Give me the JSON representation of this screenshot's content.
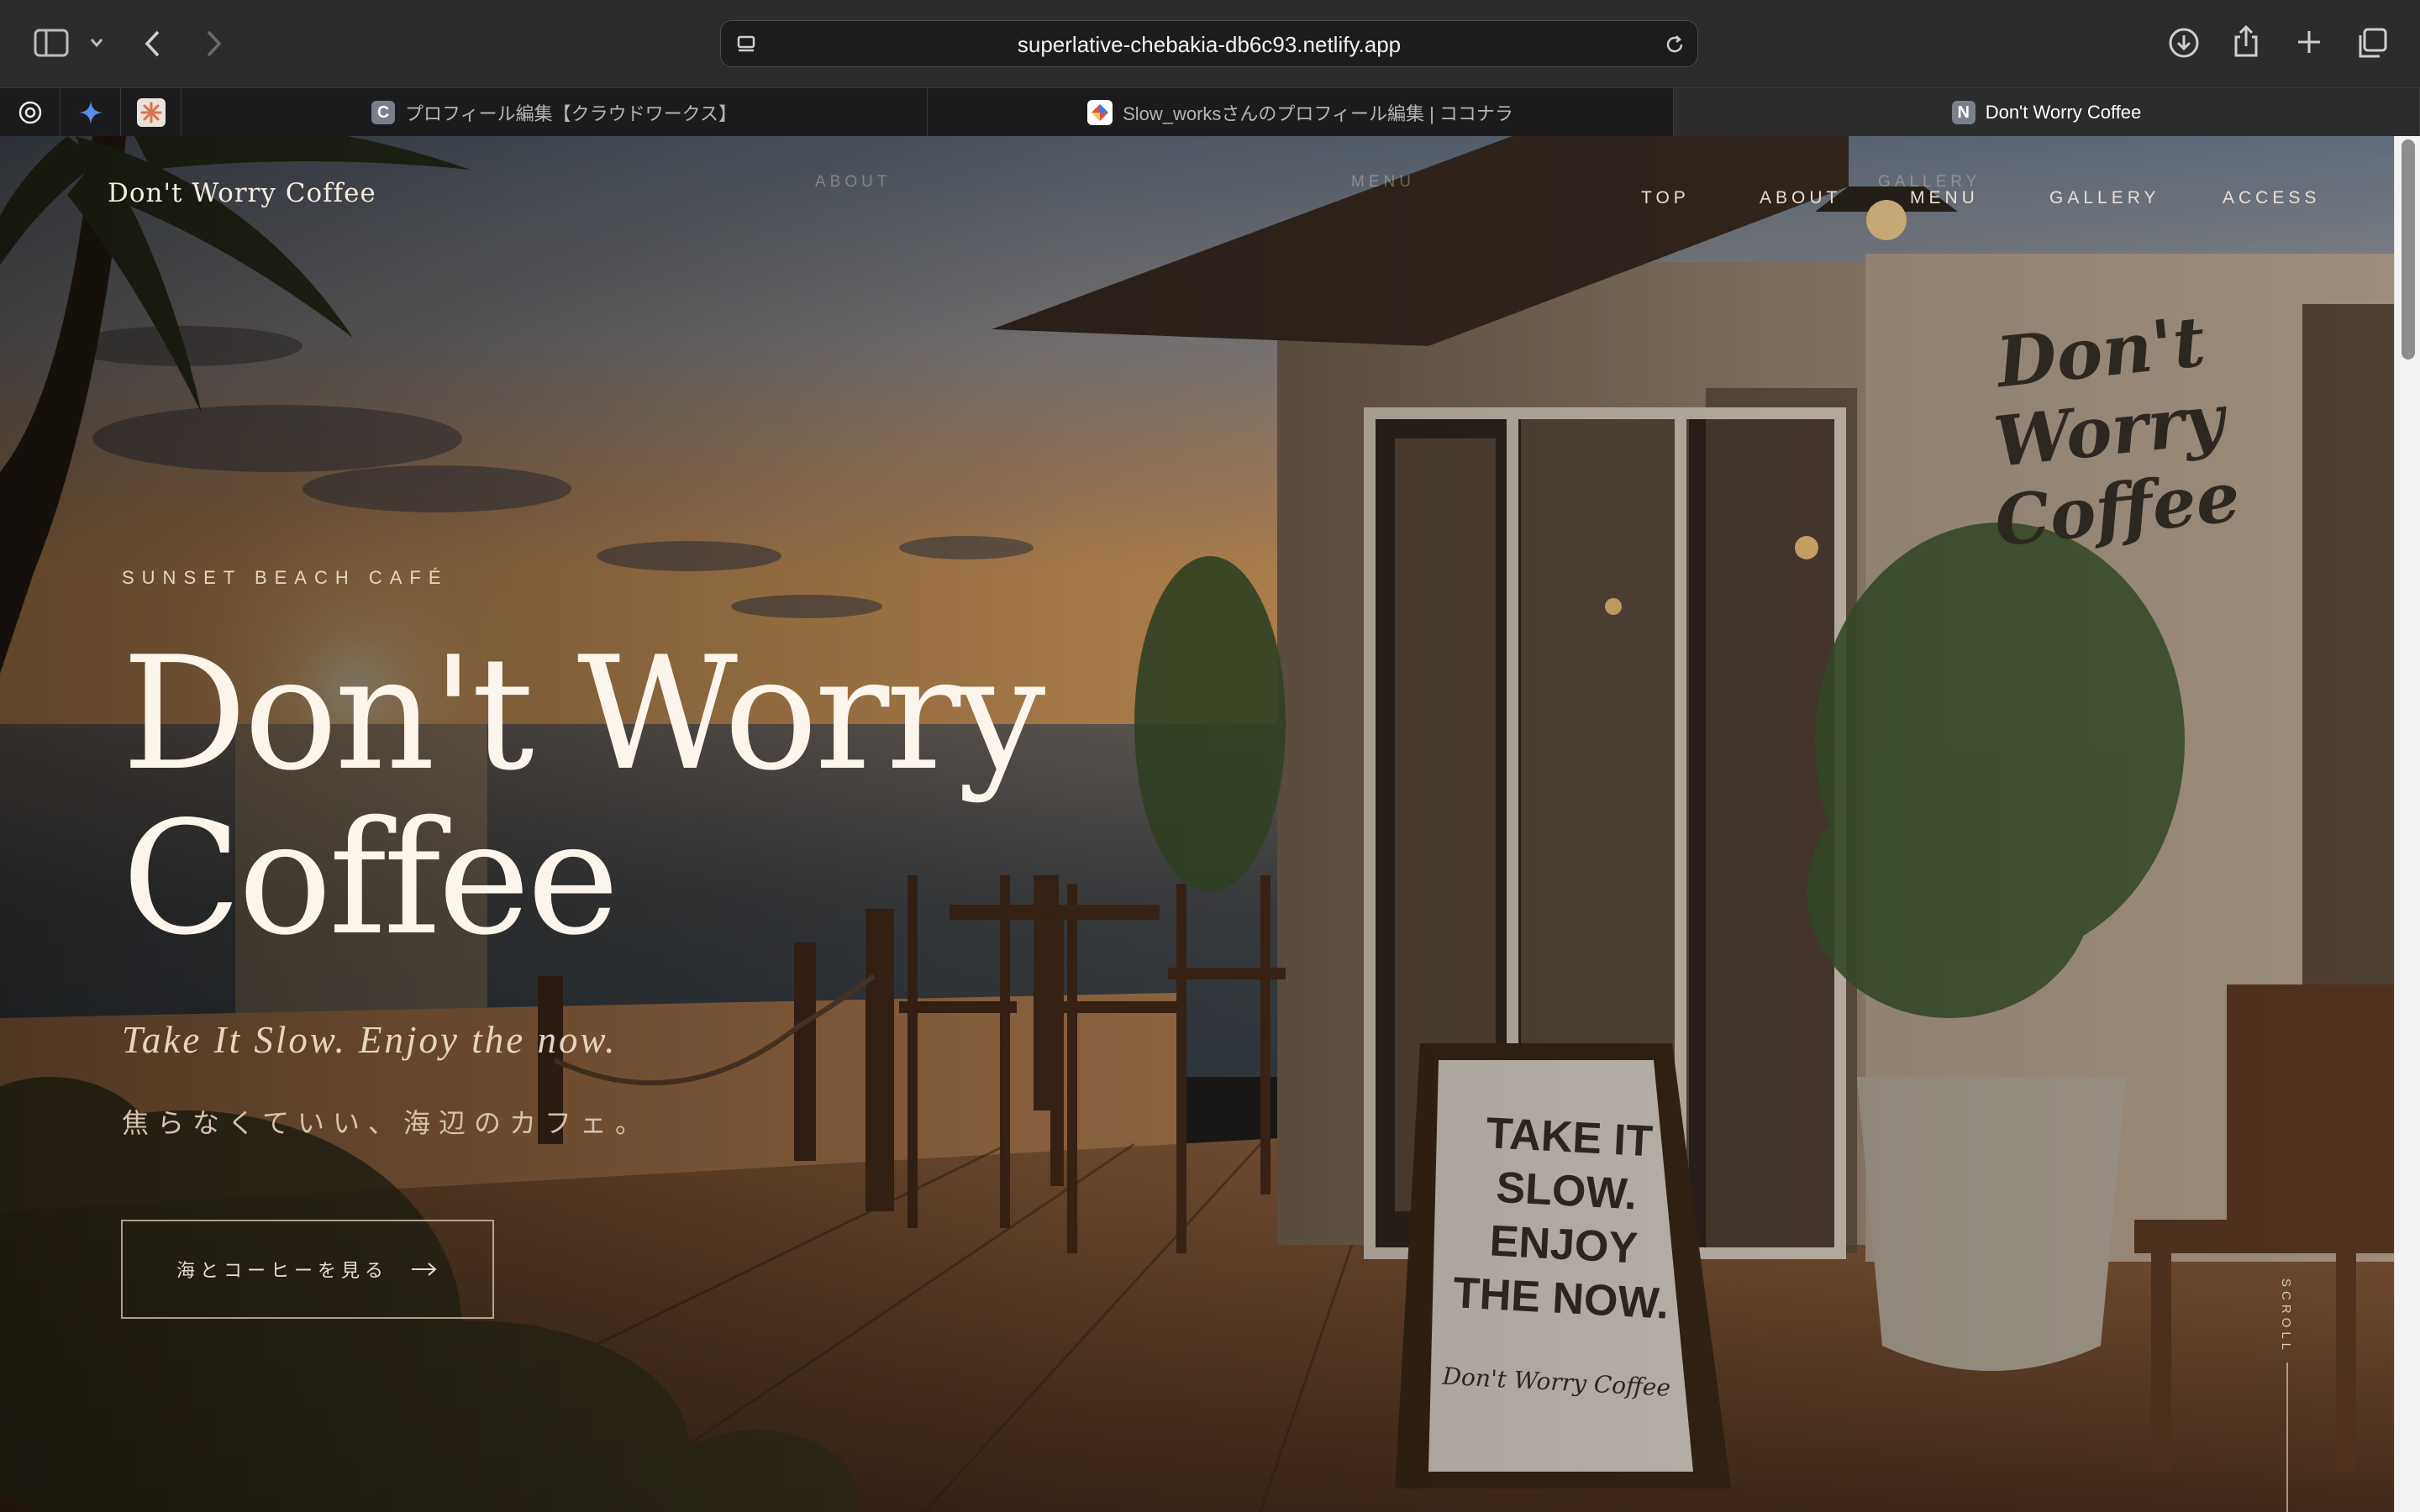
{
  "browser": {
    "url": "superlative-chebakia-db6c93.netlify.app",
    "tabs": [
      {
        "favicon_letter": "C",
        "favicon_color": "#7a7f8c",
        "title": "プロフィール編集【クラウドワークス】",
        "active": false
      },
      {
        "favicon_letter": "",
        "favicon_color": "#e94b3c",
        "title": "Slow_worksさんのプロフィール編集 | ココナラ",
        "active": false
      },
      {
        "favicon_letter": "N",
        "favicon_color": "#7a7f8c",
        "title": "Don't Worry Coffee",
        "active": true
      }
    ],
    "pinned_tabs": [
      "openai-icon",
      "gemini-icon",
      "claude-icon"
    ]
  },
  "site": {
    "logo": "Don't Worry Coffee",
    "nav": [
      "TOP",
      "ABOUT",
      "MENU",
      "GALLERY",
      "ACCESS"
    ],
    "ghost_nav": [
      "ABOUT",
      "MENU",
      "GALLERY"
    ],
    "eyebrow": "SUNSET BEACH CAFÉ",
    "title_line1": "Don't Worry",
    "title_line2": "Coffee",
    "tagline": "Take It Slow. Enjoy the now.",
    "tagline_ja": "焦らなくていい、海辺のカフェ。",
    "cta_label": "海とコーヒーを見る",
    "scroll_label": "SCROLL"
  },
  "scene": {
    "wall_sign_line1": "Don't Worry",
    "wall_sign_line2": "Coffee",
    "board_lines": [
      "TAKE IT",
      "SLOW.",
      "ENJOY",
      "THE NOW."
    ],
    "board_signature": "Don't Worry Coffee"
  },
  "colors": {
    "accent": "#fbf5ec",
    "sky_top": "#6e7f93",
    "sunset": "#f3b36a",
    "sea": "#3c4a55",
    "wood": "#7a5236"
  }
}
